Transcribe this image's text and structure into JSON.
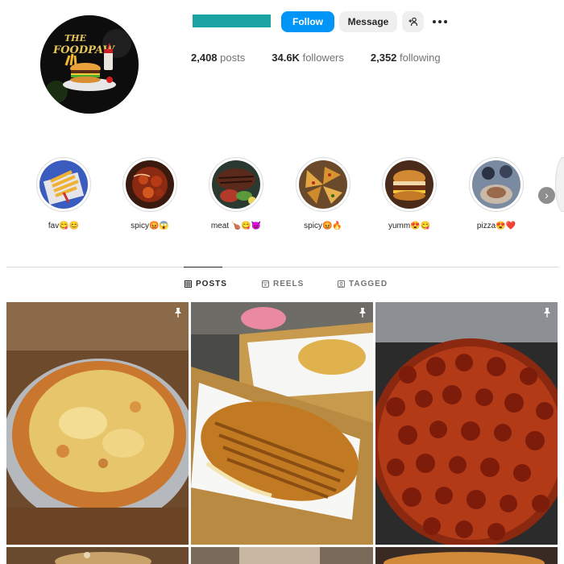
{
  "profile": {
    "avatar_text": "THE FOODPAW",
    "follow_label": "Follow",
    "message_label": "Message",
    "stats": {
      "posts_value": "2,408",
      "posts_label": "posts",
      "followers_value": "34.6K",
      "followers_label": "followers",
      "following_value": "2,352",
      "following_label": "following"
    }
  },
  "highlights": [
    {
      "label": "fav😋😊",
      "icon": "fries"
    },
    {
      "label": "spicy😡😱",
      "icon": "chili-pasta"
    },
    {
      "label": "meat 🍗😋😈",
      "icon": "steak"
    },
    {
      "label": "spicy😡🔥",
      "icon": "pizza-slices"
    },
    {
      "label": "yumm😍😋",
      "icon": "burger"
    },
    {
      "label": "pizza😍❤️",
      "icon": "pizza-chef"
    }
  ],
  "tabs": [
    {
      "label": "POSTS",
      "active": true
    },
    {
      "label": "REELS",
      "active": false
    },
    {
      "label": "TAGGED",
      "active": false
    }
  ],
  "posts": [
    {
      "subject": "cheese pizza",
      "pinned": true
    },
    {
      "subject": "grilled panini",
      "pinned": true
    },
    {
      "subject": "pepperoni pizza",
      "pinned": true
    }
  ],
  "colors": {
    "accent": "#0095f6",
    "username_bar": "#1aa3a0",
    "secondary_button": "#efefef"
  }
}
